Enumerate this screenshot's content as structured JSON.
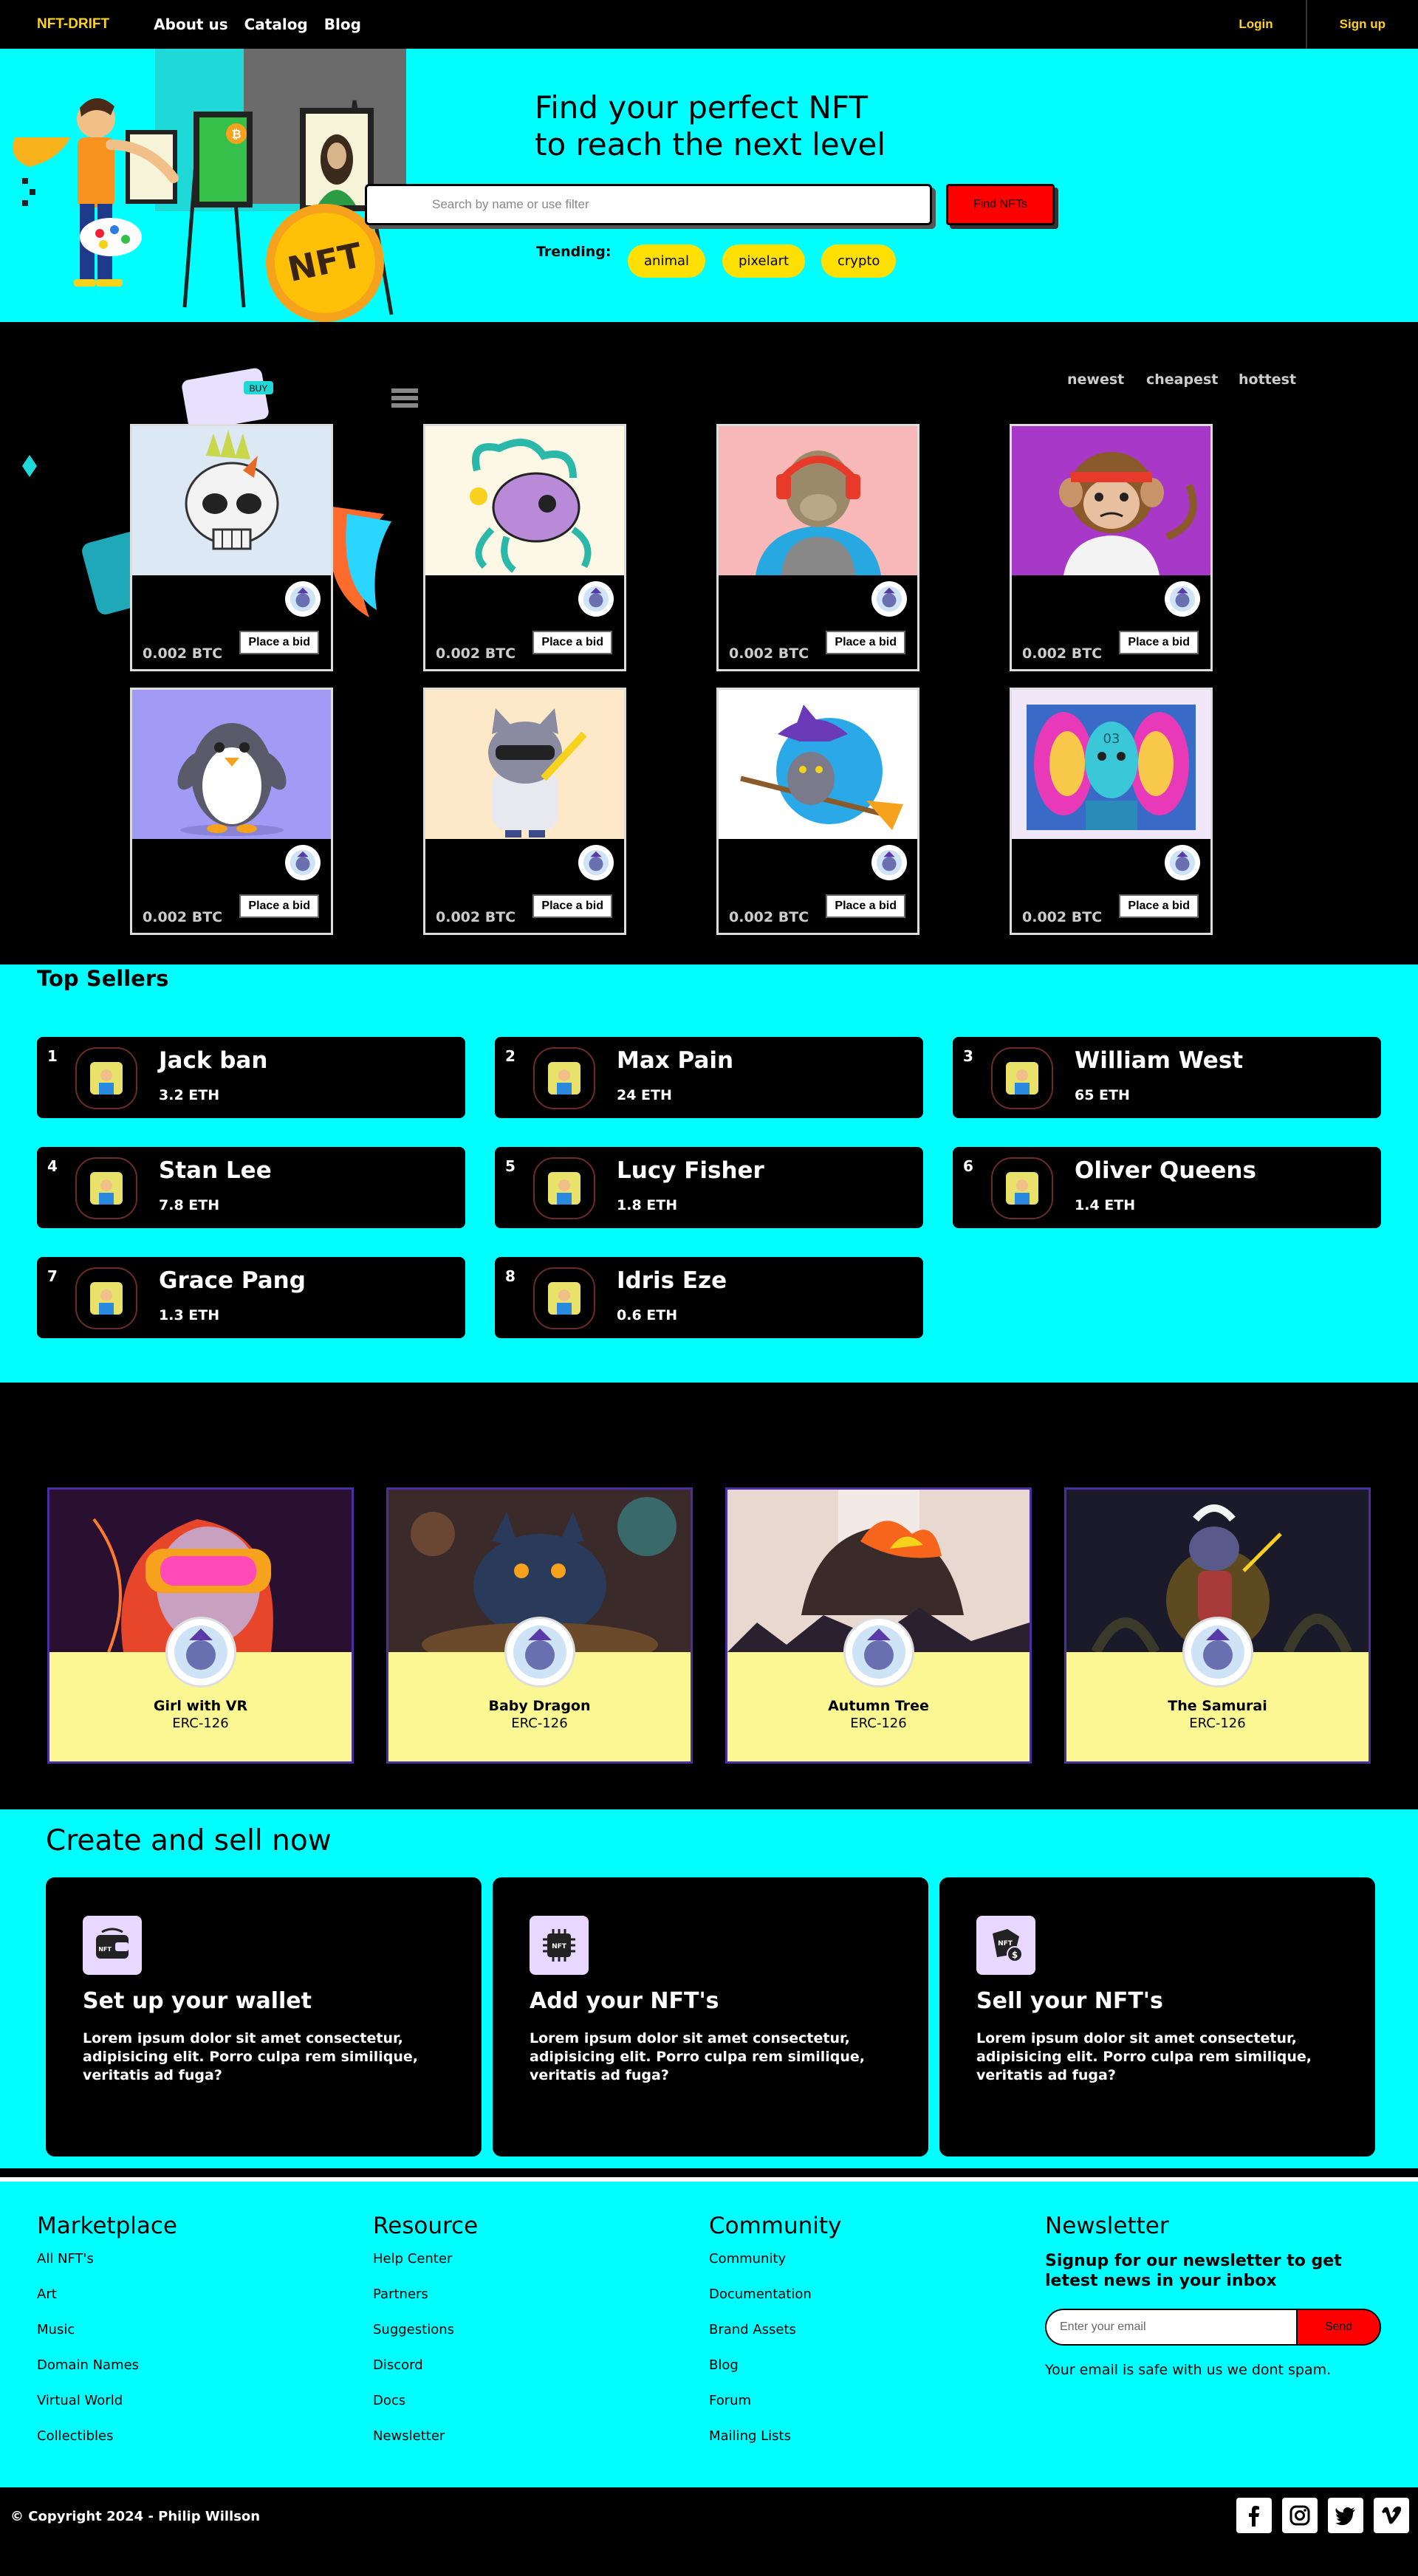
{
  "nav": {
    "brand": "NFT-DRIFT",
    "links": [
      "About us",
      "Catalog",
      "Blog"
    ],
    "login": "Login",
    "signup": "Sign up"
  },
  "hero": {
    "title_line1": "Find your perfect NFT",
    "title_line2": "to reach the next level",
    "search_placeholder": "Search by name or use filter",
    "find_button": "Find NFTs",
    "trending_label": "Trending:",
    "tags": [
      "animal",
      "pixelart",
      "crypto"
    ]
  },
  "gallery": {
    "sort": [
      "newest",
      "cheapest",
      "hottest"
    ],
    "cards": [
      {
        "price": "0.002 BTC",
        "bid": "Place a bid",
        "art": "skull-art"
      },
      {
        "price": "0.002 BTC",
        "bid": "Place a bid",
        "art": "octopus-skull-art"
      },
      {
        "price": "0.002 BTC",
        "bid": "Place a bid",
        "art": "ape-headphones-art"
      },
      {
        "price": "0.002 BTC",
        "bid": "Place a bid",
        "art": "monkey-headband-art"
      },
      {
        "price": "0.002 BTC",
        "bid": "Place a bid",
        "art": "penguin-art"
      },
      {
        "price": "0.002 BTC",
        "bid": "Place a bid",
        "art": "cool-cat-art"
      },
      {
        "price": "0.002 BTC",
        "bid": "Place a bid",
        "art": "witch-cat-art"
      },
      {
        "price": "0.002 BTC",
        "bid": "Place a bid",
        "art": "twin-faces-art"
      }
    ],
    "twin_faces_number": "03"
  },
  "sellers": {
    "title": "Top Sellers",
    "items": [
      {
        "rank": "1",
        "name": "Jack ban",
        "eth": "3.2 ETH"
      },
      {
        "rank": "2",
        "name": "Max Pain",
        "eth": "24 ETH"
      },
      {
        "rank": "3",
        "name": "William West",
        "eth": "65 ETH"
      },
      {
        "rank": "4",
        "name": "Stan Lee",
        "eth": "7.8 ETH"
      },
      {
        "rank": "5",
        "name": "Lucy Fisher",
        "eth": "1.8 ETH"
      },
      {
        "rank": "6",
        "name": "Oliver Queens",
        "eth": "1.4 ETH"
      },
      {
        "rank": "7",
        "name": "Grace Pang",
        "eth": "1.3 ETH"
      },
      {
        "rank": "8",
        "name": "Idris Eze",
        "eth": "0.6 ETH"
      }
    ]
  },
  "featured": [
    {
      "name": "Girl with VR",
      "standard": "ERC-126"
    },
    {
      "name": "Baby Dragon",
      "standard": "ERC-126"
    },
    {
      "name": "Autumn Tree",
      "standard": "ERC-126"
    },
    {
      "name": "The Samurai",
      "standard": "ERC-126"
    }
  ],
  "create": {
    "title": "Create and sell now",
    "cards": [
      {
        "heading": "Set up your wallet",
        "text": "Lorem ipsum dolor sit amet consectetur, adipisicing elit. Porro culpa rem similique, veritatis ad fuga?",
        "icon": "wallet-icon"
      },
      {
        "heading": "Add your NFT's",
        "text": "Lorem ipsum dolor sit amet consectetur, adipisicing elit. Porro culpa rem similique, veritatis ad fuga?",
        "icon": "nft-chip-icon"
      },
      {
        "heading": "Sell your NFT's",
        "text": "Lorem ipsum dolor sit amet consectetur, adipisicing elit. Porro culpa rem similique, veritatis ad fuga?",
        "icon": "nft-sell-icon"
      }
    ],
    "icon_label": "NFT"
  },
  "footer": {
    "marketplace": {
      "title": "Marketplace",
      "links": [
        "All NFT's",
        "Art",
        "Music",
        "Domain Names",
        "Virtual World",
        "Collectibles"
      ]
    },
    "resource": {
      "title": "Resource",
      "links": [
        "Help Center",
        "Partners",
        "Suggestions",
        "Discord",
        "Docs",
        "Newsletter"
      ]
    },
    "community": {
      "title": "Community",
      "links": [
        "Community",
        "Documentation",
        "Brand Assets",
        "Blog",
        "Forum",
        "Mailing Lists"
      ]
    },
    "newsletter": {
      "title": "Newsletter",
      "subtitle": "Signup for our newsletter to get letest news in your inbox",
      "placeholder": "Enter your email",
      "button": "Send",
      "note": "Your email is safe with us we dont spam."
    },
    "copyright": "© Copyright 2024 - Philip Willson",
    "socials": [
      "facebook-icon",
      "instagram-icon",
      "twitter-icon",
      "vimeo-icon"
    ]
  },
  "colors": {
    "accent": "#00ffff",
    "brand": "#ffd21a",
    "cta": "#ff0000",
    "tag": "#ffe000"
  }
}
